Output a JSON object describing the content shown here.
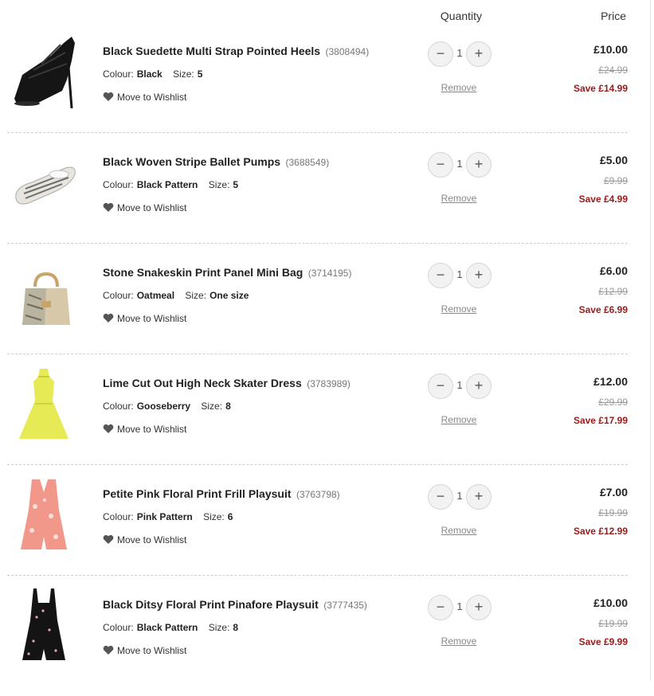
{
  "header": {
    "quantity_label": "Quantity",
    "price_label": "Price"
  },
  "labels": {
    "colour": "Colour:",
    "size": "Size:",
    "wishlist": "Move to Wishlist",
    "remove": "Remove",
    "minus": "−",
    "plus": "+"
  },
  "items": [
    {
      "name": "Black Suedette Multi Strap Pointed Heels",
      "code": "(3808494)",
      "colour": "Black",
      "size": "5",
      "qty": "1",
      "price": "£10.00",
      "was": "£24.99",
      "save": "Save  £14.99"
    },
    {
      "name": "Black Woven Stripe Ballet Pumps",
      "code": "(3688549)",
      "colour": "Black Pattern",
      "size": "5",
      "qty": "1",
      "price": "£5.00",
      "was": "£9.99",
      "save": "Save  £4.99"
    },
    {
      "name": "Stone Snakeskin Print Panel Mini Bag",
      "code": "(3714195)",
      "colour": "Oatmeal",
      "size": "One size",
      "qty": "1",
      "price": "£6.00",
      "was": "£12.99",
      "save": "Save  £6.99"
    },
    {
      "name": "Lime Cut Out High Neck Skater Dress",
      "code": "(3783989)",
      "colour": "Gooseberry",
      "size": "8",
      "qty": "1",
      "price": "£12.00",
      "was": "£29.99",
      "save": "Save  £17.99"
    },
    {
      "name": "Petite Pink Floral Print Frill Playsuit",
      "code": "(3763798)",
      "colour": "Pink Pattern",
      "size": "6",
      "qty": "1",
      "price": "£7.00",
      "was": "£19.99",
      "save": "Save  £12.99"
    },
    {
      "name": "Black Ditsy Floral Print Pinafore Playsuit",
      "code": "(3777435)",
      "colour": "Black Pattern",
      "size": "8",
      "qty": "1",
      "price": "£10.00",
      "was": "£19.99",
      "save": "Save  £9.99"
    }
  ],
  "colors": {
    "save_red": "#9a1a1a",
    "wishlist_heart": "#555555"
  }
}
